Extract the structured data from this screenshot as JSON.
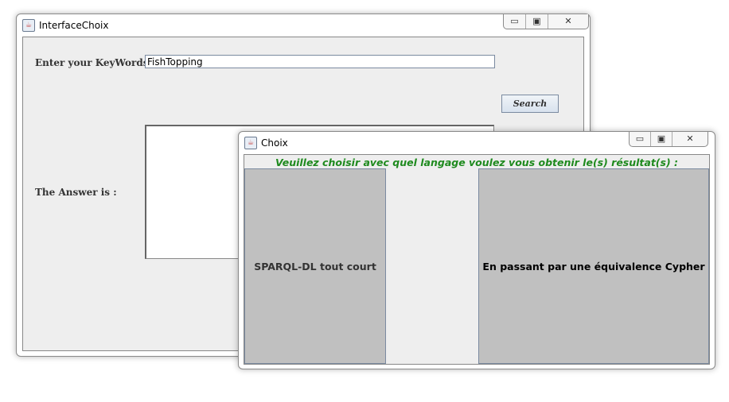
{
  "main_window": {
    "title": "InterfaceChoix",
    "keywords_label": "Enter your KeyWords :",
    "keywords_value": "FishTopping",
    "search_label": "Search",
    "answer_label": "The Answer is :",
    "answer_value": ""
  },
  "choice_window": {
    "title": "Choix",
    "prompt": "Veuillez choisir avec quel langage voulez vous obtenir le(s) résultat(s) :",
    "option_1": "SPARQL-DL tout court",
    "option_2": "En passant par une équivalence Cypher",
    "prompt_color": "#1e8a1e"
  },
  "window_controls": {
    "minimize": "▭",
    "maximize": "▣",
    "close": "✕"
  }
}
